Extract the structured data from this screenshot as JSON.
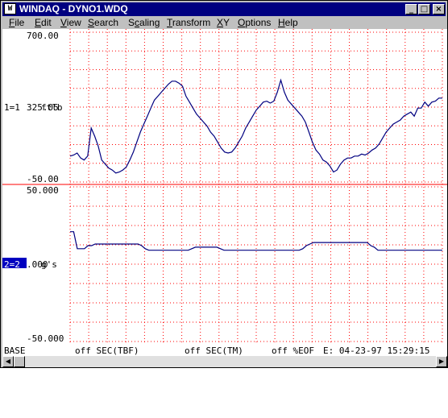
{
  "window": {
    "app_icon": "windaq-app-icon",
    "title": "WINDAQ - DYNO1.WDQ",
    "minimize_glyph": "_",
    "maximize_glyph": "□",
    "close_glyph": "×"
  },
  "menu": [
    "File",
    "Edit",
    "View",
    "Search",
    "Scaling",
    "Transform",
    "XY",
    "Options",
    "Help"
  ],
  "menu_mnemonics": [
    "F",
    "E",
    "V",
    "S",
    "c",
    "T",
    "X",
    "O",
    "H"
  ],
  "channels": [
    {
      "id": "1=1",
      "unit": "ftlb",
      "top": "700.00",
      "mid": "325.05",
      "bottom": "-50.00",
      "selected": false,
      "line_color": "#000080"
    },
    {
      "id": "2=2",
      "unit": "g's",
      "top": "50.000",
      "mid": ".000",
      "bottom": "-50.000",
      "selected": true,
      "line_color": "#000080"
    }
  ],
  "grid_color": "#ff0000",
  "chart_data": {
    "type": "line",
    "series": [
      {
        "channel": "1=1",
        "ylim": [
          -50,
          700
        ],
        "values": [
          80,
          85,
          95,
          70,
          60,
          80,
          220,
          180,
          130,
          60,
          40,
          20,
          10,
          -5,
          0,
          10,
          25,
          60,
          100,
          150,
          200,
          240,
          280,
          320,
          360,
          380,
          400,
          420,
          440,
          455,
          455,
          445,
          430,
          380,
          350,
          320,
          290,
          270,
          250,
          230,
          200,
          180,
          150,
          120,
          100,
          95,
          100,
          120,
          150,
          180,
          220,
          250,
          280,
          310,
          330,
          350,
          355,
          345,
          355,
          400,
          460,
          400,
          360,
          340,
          320,
          300,
          280,
          250,
          200,
          150,
          110,
          90,
          60,
          50,
          30,
          0,
          10,
          40,
          60,
          70,
          70,
          80,
          80,
          90,
          85,
          95,
          110,
          120,
          140,
          170,
          200,
          220,
          240,
          250,
          260,
          280,
          290,
          300,
          280,
          320,
          320,
          350,
          330,
          350,
          355,
          370,
          370
        ]
      },
      {
        "channel": "2=2",
        "ylim": [
          -50,
          50
        ],
        "values": [
          21,
          21,
          10,
          10,
          10,
          12,
          12,
          13,
          13,
          13,
          13,
          13,
          13,
          13,
          13,
          13,
          13,
          13,
          13,
          13,
          12,
          10,
          9,
          9,
          9,
          9,
          9,
          9,
          9,
          9,
          9,
          9,
          9,
          9,
          10,
          11,
          11,
          11,
          11,
          11,
          11,
          11,
          10,
          9,
          9,
          9,
          9,
          9,
          9,
          9,
          9,
          9,
          9,
          9,
          9,
          9,
          9,
          9,
          9,
          9,
          9,
          9,
          9,
          9,
          9,
          10,
          12,
          13,
          14,
          14,
          14,
          14,
          14,
          14,
          14,
          14,
          14,
          14,
          14,
          14,
          14,
          14,
          14,
          14,
          12,
          11,
          9,
          9,
          9,
          9,
          9,
          9,
          9,
          9,
          9,
          9,
          9,
          9,
          9,
          9,
          9,
          9,
          9,
          9,
          9
        ]
      }
    ]
  },
  "status": {
    "base": "BASE",
    "sec_tbf": "off SEC(TBF)",
    "sec_tm": "off SEC(TM)",
    "eof": "off %EOF",
    "datetime": "E: 04-23-97 15:29:15"
  },
  "icons": {
    "scroll_left": "arrow-left-icon",
    "scroll_right": "arrow-right-icon"
  }
}
